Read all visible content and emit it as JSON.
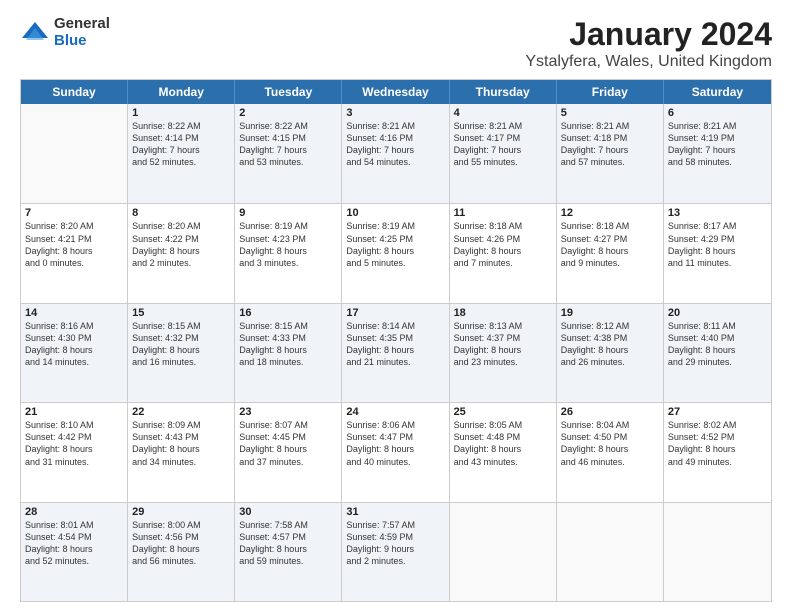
{
  "logo": {
    "general": "General",
    "blue": "Blue"
  },
  "title": "January 2024",
  "subtitle": "Ystalyfera, Wales, United Kingdom",
  "header_days": [
    "Sunday",
    "Monday",
    "Tuesday",
    "Wednesday",
    "Thursday",
    "Friday",
    "Saturday"
  ],
  "weeks": [
    [
      {
        "day": "",
        "lines": []
      },
      {
        "day": "1",
        "lines": [
          "Sunrise: 8:22 AM",
          "Sunset: 4:14 PM",
          "Daylight: 7 hours",
          "and 52 minutes."
        ]
      },
      {
        "day": "2",
        "lines": [
          "Sunrise: 8:22 AM",
          "Sunset: 4:15 PM",
          "Daylight: 7 hours",
          "and 53 minutes."
        ]
      },
      {
        "day": "3",
        "lines": [
          "Sunrise: 8:21 AM",
          "Sunset: 4:16 PM",
          "Daylight: 7 hours",
          "and 54 minutes."
        ]
      },
      {
        "day": "4",
        "lines": [
          "Sunrise: 8:21 AM",
          "Sunset: 4:17 PM",
          "Daylight: 7 hours",
          "and 55 minutes."
        ]
      },
      {
        "day": "5",
        "lines": [
          "Sunrise: 8:21 AM",
          "Sunset: 4:18 PM",
          "Daylight: 7 hours",
          "and 57 minutes."
        ]
      },
      {
        "day": "6",
        "lines": [
          "Sunrise: 8:21 AM",
          "Sunset: 4:19 PM",
          "Daylight: 7 hours",
          "and 58 minutes."
        ]
      }
    ],
    [
      {
        "day": "7",
        "lines": [
          "Sunrise: 8:20 AM",
          "Sunset: 4:21 PM",
          "Daylight: 8 hours",
          "and 0 minutes."
        ]
      },
      {
        "day": "8",
        "lines": [
          "Sunrise: 8:20 AM",
          "Sunset: 4:22 PM",
          "Daylight: 8 hours",
          "and 2 minutes."
        ]
      },
      {
        "day": "9",
        "lines": [
          "Sunrise: 8:19 AM",
          "Sunset: 4:23 PM",
          "Daylight: 8 hours",
          "and 3 minutes."
        ]
      },
      {
        "day": "10",
        "lines": [
          "Sunrise: 8:19 AM",
          "Sunset: 4:25 PM",
          "Daylight: 8 hours",
          "and 5 minutes."
        ]
      },
      {
        "day": "11",
        "lines": [
          "Sunrise: 8:18 AM",
          "Sunset: 4:26 PM",
          "Daylight: 8 hours",
          "and 7 minutes."
        ]
      },
      {
        "day": "12",
        "lines": [
          "Sunrise: 8:18 AM",
          "Sunset: 4:27 PM",
          "Daylight: 8 hours",
          "and 9 minutes."
        ]
      },
      {
        "day": "13",
        "lines": [
          "Sunrise: 8:17 AM",
          "Sunset: 4:29 PM",
          "Daylight: 8 hours",
          "and 11 minutes."
        ]
      }
    ],
    [
      {
        "day": "14",
        "lines": [
          "Sunrise: 8:16 AM",
          "Sunset: 4:30 PM",
          "Daylight: 8 hours",
          "and 14 minutes."
        ]
      },
      {
        "day": "15",
        "lines": [
          "Sunrise: 8:15 AM",
          "Sunset: 4:32 PM",
          "Daylight: 8 hours",
          "and 16 minutes."
        ]
      },
      {
        "day": "16",
        "lines": [
          "Sunrise: 8:15 AM",
          "Sunset: 4:33 PM",
          "Daylight: 8 hours",
          "and 18 minutes."
        ]
      },
      {
        "day": "17",
        "lines": [
          "Sunrise: 8:14 AM",
          "Sunset: 4:35 PM",
          "Daylight: 8 hours",
          "and 21 minutes."
        ]
      },
      {
        "day": "18",
        "lines": [
          "Sunrise: 8:13 AM",
          "Sunset: 4:37 PM",
          "Daylight: 8 hours",
          "and 23 minutes."
        ]
      },
      {
        "day": "19",
        "lines": [
          "Sunrise: 8:12 AM",
          "Sunset: 4:38 PM",
          "Daylight: 8 hours",
          "and 26 minutes."
        ]
      },
      {
        "day": "20",
        "lines": [
          "Sunrise: 8:11 AM",
          "Sunset: 4:40 PM",
          "Daylight: 8 hours",
          "and 29 minutes."
        ]
      }
    ],
    [
      {
        "day": "21",
        "lines": [
          "Sunrise: 8:10 AM",
          "Sunset: 4:42 PM",
          "Daylight: 8 hours",
          "and 31 minutes."
        ]
      },
      {
        "day": "22",
        "lines": [
          "Sunrise: 8:09 AM",
          "Sunset: 4:43 PM",
          "Daylight: 8 hours",
          "and 34 minutes."
        ]
      },
      {
        "day": "23",
        "lines": [
          "Sunrise: 8:07 AM",
          "Sunset: 4:45 PM",
          "Daylight: 8 hours",
          "and 37 minutes."
        ]
      },
      {
        "day": "24",
        "lines": [
          "Sunrise: 8:06 AM",
          "Sunset: 4:47 PM",
          "Daylight: 8 hours",
          "and 40 minutes."
        ]
      },
      {
        "day": "25",
        "lines": [
          "Sunrise: 8:05 AM",
          "Sunset: 4:48 PM",
          "Daylight: 8 hours",
          "and 43 minutes."
        ]
      },
      {
        "day": "26",
        "lines": [
          "Sunrise: 8:04 AM",
          "Sunset: 4:50 PM",
          "Daylight: 8 hours",
          "and 46 minutes."
        ]
      },
      {
        "day": "27",
        "lines": [
          "Sunrise: 8:02 AM",
          "Sunset: 4:52 PM",
          "Daylight: 8 hours",
          "and 49 minutes."
        ]
      }
    ],
    [
      {
        "day": "28",
        "lines": [
          "Sunrise: 8:01 AM",
          "Sunset: 4:54 PM",
          "Daylight: 8 hours",
          "and 52 minutes."
        ]
      },
      {
        "day": "29",
        "lines": [
          "Sunrise: 8:00 AM",
          "Sunset: 4:56 PM",
          "Daylight: 8 hours",
          "and 56 minutes."
        ]
      },
      {
        "day": "30",
        "lines": [
          "Sunrise: 7:58 AM",
          "Sunset: 4:57 PM",
          "Daylight: 8 hours",
          "and 59 minutes."
        ]
      },
      {
        "day": "31",
        "lines": [
          "Sunrise: 7:57 AM",
          "Sunset: 4:59 PM",
          "Daylight: 9 hours",
          "and 2 minutes."
        ]
      },
      {
        "day": "",
        "lines": []
      },
      {
        "day": "",
        "lines": []
      },
      {
        "day": "",
        "lines": []
      }
    ]
  ],
  "alt_weeks": [
    0,
    2,
    4
  ]
}
